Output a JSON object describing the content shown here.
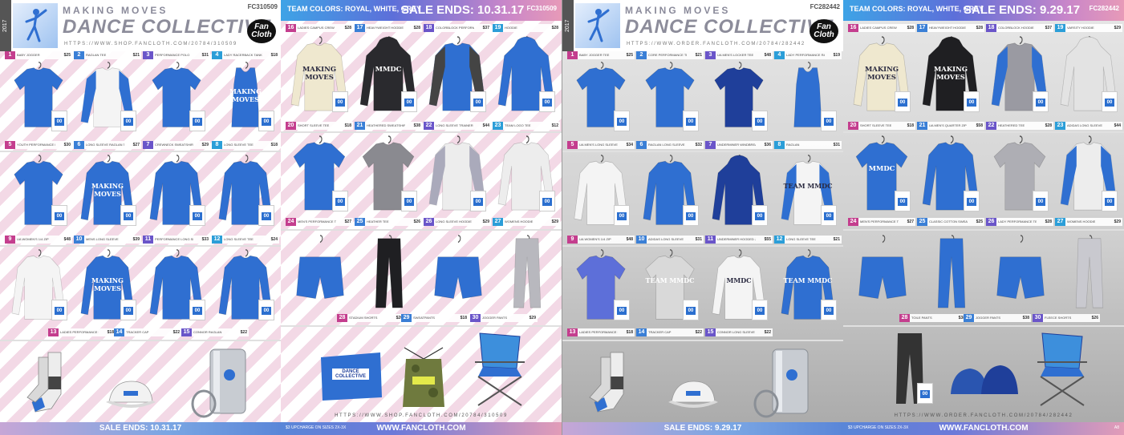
{
  "colors": {
    "royal": "#2f6fd1",
    "white": "#f4f4f4",
    "grey": "#9a9aa2",
    "black": "#1f1f22",
    "cream": "#efe8cf"
  },
  "catalogs": [
    {
      "year": "2017",
      "brand_sub": "MAKING MOVES",
      "brand_main": "DANCE COLLECTIVE",
      "brand_url": "HTTPS://WWW.SHOP.FANCLOTH.COM/20784/310509",
      "fc_code": "FC310509",
      "fancloth": "Fan Cloth",
      "team_colors": "TEAM COLORS: ROYAL, WHITE, GREY",
      "sale_banner": "SALE ENDS: 10.31.17",
      "footer_sale": "SALE ENDS: 10.31.17",
      "footer_note": "$3 UPCHARGE ON SIZES 2X-3X",
      "footer_site": "WWW.FANCLOTH.COM",
      "bottom_url": "HTTPS://WWW.SHOP.FANCLOTH.COM/20784/310509",
      "left_products": [
        {
          "num": "1",
          "name": "BABY JOGGER",
          "price": "$25"
        },
        {
          "num": "2",
          "name": "RAGLAN TEE",
          "price": "$21"
        },
        {
          "num": "3",
          "name": "PERFORMANCE POLO",
          "price": "$31"
        },
        {
          "num": "4",
          "name": "LADY RACERBACK TANK",
          "price": "$18"
        },
        {
          "num": "5",
          "name": "YOUTH PERFORMANCE LS TEE",
          "price": "$30"
        },
        {
          "num": "6",
          "name": "LONG SLEEVE RAGLAN TEE",
          "price": "$27"
        },
        {
          "num": "7",
          "name": "CREWNECK SWEATSHIRT",
          "price": "$29"
        },
        {
          "num": "8",
          "name": "LONG SLEEVE TEE",
          "price": "$18"
        },
        {
          "num": "9",
          "name": "UA WOMEN'S 1/4 ZIP",
          "price": "$48"
        },
        {
          "num": "10",
          "name": "MENS LONG SLEEVE",
          "price": "$39"
        },
        {
          "num": "11",
          "name": "PERFORMANCE LONG SLEEVE",
          "price": "$33"
        },
        {
          "num": "12",
          "name": "LONG SLEEVE TEE",
          "price": "$24"
        },
        {
          "num": "13",
          "name": "LADIES PERFORMANCE POLO",
          "price": "$18"
        },
        {
          "num": "14",
          "name": "TRACKER CAP",
          "price": "$22"
        },
        {
          "num": "15",
          "name": "CONNOR RAGLAN",
          "price": "$22"
        }
      ],
      "right_products": [
        {
          "num": "16",
          "name": "LADIES CAMPUS CREW",
          "price": "$28"
        },
        {
          "num": "17",
          "name": "HEAVYWEIGHT HOODIE",
          "price": "$28"
        },
        {
          "num": "18",
          "name": "COLORBLOCK PERFORMANCE",
          "price": "$37"
        },
        {
          "num": "19",
          "name": "HOODIE",
          "price": "$28"
        },
        {
          "num": "20",
          "name": "SHORT SLEEVE TEE",
          "price": "$18"
        },
        {
          "num": "21",
          "name": "HEATHERED SWEATSHIRT",
          "price": "$38"
        },
        {
          "num": "22",
          "name": "LONG SLEEVE TRAINER",
          "price": "$44"
        },
        {
          "num": "23",
          "name": "TEAM LOGO TEE",
          "price": "$12"
        },
        {
          "num": "24",
          "name": "MEN'S PERFORMANCE TEE",
          "price": "$27"
        },
        {
          "num": "25",
          "name": "HEATHER TEE",
          "price": "$26"
        },
        {
          "num": "26",
          "name": "LONG SLEEVE HOODIE",
          "price": "$29"
        },
        {
          "num": "27",
          "name": "WOMENS HOODIE",
          "price": "$29"
        },
        {
          "num": "28",
          "name": "STADIUM SHORTS",
          "price": "$20"
        },
        {
          "num": "29",
          "name": "SWEATPANTS",
          "price": "$18"
        },
        {
          "num": "30",
          "name": "JOGGER PANTS",
          "price": "$29"
        }
      ],
      "mmdc_text": "MMDC",
      "making_moves_text": "MAKING MOVES",
      "number_text": "00"
    },
    {
      "year": "2017",
      "brand_sub": "MAKING MOVES",
      "brand_main": "DANCE COLLECTIVE",
      "brand_url": "HTTPS://WWW.ORDER.FANCLOTH.COM/20784/282442",
      "fc_code": "FC282442",
      "fancloth": "Fan Cloth",
      "team_colors": "TEAM COLORS: ROYAL, WHITE, GREY",
      "sale_banner": "SALE ENDS: 9.29.17",
      "footer_sale": "SALE ENDS: 9.29.17",
      "footer_note": "$3 UPCHARGE ON SIZES 2X-3X",
      "footer_site": "WWW.FANCLOTH.COM",
      "footer_right": "A8",
      "bottom_url": "HTTPS://WWW.ORDER.FANCLOTH.COM/20784/282442",
      "left_products": [
        {
          "num": "1",
          "name": "BABY JOGGER TEE",
          "price": "$25"
        },
        {
          "num": "2",
          "name": "CORE PERFORMANCE TEE",
          "price": "$21"
        },
        {
          "num": "3",
          "name": "UA MEN'S LOCKER TEE",
          "price": "$48"
        },
        {
          "num": "4",
          "name": "LADY PERFORMANCE RACERBACK",
          "price": "$19"
        },
        {
          "num": "5",
          "name": "UA MEN'S LONG SLEEVE",
          "price": "$34"
        },
        {
          "num": "6",
          "name": "RAGLAN LONG SLEEVE",
          "price": "$32"
        },
        {
          "num": "7",
          "name": "UNDERMINER WINDBREAKER",
          "price": "$36"
        },
        {
          "num": "8",
          "name": "RAGLAN",
          "price": "$31"
        },
        {
          "num": "9",
          "name": "UA WOMEN'S 1/4 ZIP",
          "price": "$48"
        },
        {
          "num": "10",
          "name": "ADIDAS LONG SLEEVE",
          "price": "$31"
        },
        {
          "num": "11",
          "name": "UNDERMINER HOODED JACKET",
          "price": "$55"
        },
        {
          "num": "12",
          "name": "LONG SLEEVE TEE",
          "price": "$21"
        },
        {
          "num": "13",
          "name": "LADIES PERFORMANCE POLO",
          "price": "$18"
        },
        {
          "num": "14",
          "name": "TRACKER CAP",
          "price": "$22"
        },
        {
          "num": "15",
          "name": "CONNOR LONG SLEEVE",
          "price": "$22"
        }
      ],
      "right_products": [
        {
          "num": "16",
          "name": "LADIES CAMPUS CREW",
          "price": "$28"
        },
        {
          "num": "17",
          "name": "HEAVYWEIGHT HOODIE",
          "price": "$28"
        },
        {
          "num": "18",
          "name": "COLORBLOCK HOODIE",
          "price": "$37"
        },
        {
          "num": "19",
          "name": "VARSITY HOODIE",
          "price": "$29"
        },
        {
          "num": "20",
          "name": "SHORT SLEEVE TEE",
          "price": "$18"
        },
        {
          "num": "21",
          "name": "UA MEN'S QUARTER ZIP",
          "price": "$58"
        },
        {
          "num": "22",
          "name": "HEATHERED TEE",
          "price": "$28"
        },
        {
          "num": "23",
          "name": "ADIDAS LONG SLEEVE",
          "price": "$44"
        },
        {
          "num": "24",
          "name": "MEN'S PERFORMANCE TEE",
          "price": "$27"
        },
        {
          "num": "25",
          "name": "CLASSIC COTTON SWEATSHIRT",
          "price": "$25"
        },
        {
          "num": "26",
          "name": "LADY PERFORMANCE TEE",
          "price": "$28"
        },
        {
          "num": "27",
          "name": "WOMENS HOODIE",
          "price": "$29"
        },
        {
          "num": "28",
          "name": "TOILE PANTS",
          "price": "$38"
        },
        {
          "num": "29",
          "name": "JOGGER PANTS",
          "price": "$38"
        },
        {
          "num": "30",
          "name": "FLEECE SHORTS",
          "price": "$26"
        }
      ],
      "mmdc_text": "MMDC",
      "making_moves_text": "MAKING MOVES",
      "team_text": "TEAM MMDC",
      "number_text": "00"
    }
  ]
}
